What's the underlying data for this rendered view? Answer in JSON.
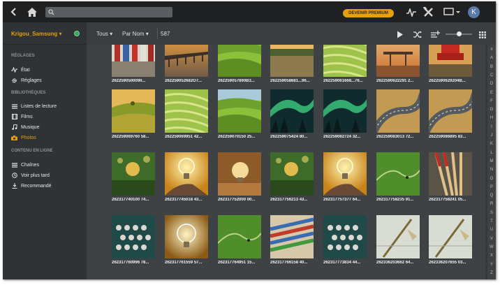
{
  "topbar": {
    "icons": [
      "back-arrow-icon",
      "home-icon",
      "search-icon",
      "activity-icon",
      "settings-tools-icon",
      "cast-icon"
    ],
    "search": {
      "value": "",
      "placeholder": ""
    },
    "premium_label": "DEVENIR PREMIUM",
    "avatar_letter": "K"
  },
  "sidebar": {
    "server_name": "Krigou_Samsung",
    "server_status_color": "#3aa65a",
    "sections": [
      {
        "title": "RÉGLAGES",
        "items": [
          {
            "label": "État",
            "icon": "activity-icon"
          },
          {
            "label": "Réglages",
            "icon": "gear-icon"
          }
        ]
      },
      {
        "title": "BIBLIOTHÈQUES",
        "items": [
          {
            "label": "Listes de lecture",
            "icon": "list-icon"
          },
          {
            "label": "Films",
            "icon": "film-icon"
          },
          {
            "label": "Musique",
            "icon": "music-note-icon"
          },
          {
            "label": "Photos",
            "icon": "camera-icon",
            "active": true
          }
        ]
      },
      {
        "title": "CONTENU EN LIGNE",
        "items": [
          {
            "label": "Chaînes",
            "icon": "list-icon"
          },
          {
            "label": "Voir plus tard",
            "icon": "clock-icon"
          },
          {
            "label": "Recommandé",
            "icon": "download-icon"
          }
        ]
      }
    ]
  },
  "toolbar": {
    "filter_label": "Tous",
    "sort_label": "Par Nom",
    "count": "587",
    "icons": [
      "play-icon",
      "shuffle-icon",
      "playlist-add-icon",
      "size-slider",
      "grid-view-icon"
    ]
  },
  "tiles": [
    {
      "label": "262259050009II...",
      "scene": "shops"
    },
    {
      "label": "262259052682O7...",
      "scene": "pier"
    },
    {
      "label": "262259057890B3...",
      "scene": "field"
    },
    {
      "label": "262259058681...96...",
      "scene": "lake"
    },
    {
      "label": "262259061668...76...",
      "scene": "rice"
    },
    {
      "label": "2622590622291 2...",
      "scene": "sunset-pier"
    },
    {
      "label": "2622590629204B...",
      "scene": "redchair"
    },
    {
      "label": "262259069760 58...",
      "scene": "hill"
    },
    {
      "label": "262259069951 42...",
      "scene": "rice"
    },
    {
      "label": "262259070150 25...",
      "scene": "field"
    },
    {
      "label": "262259075424 80...",
      "scene": "aurora"
    },
    {
      "label": "262259082724 32...",
      "scene": "aurora"
    },
    {
      "label": "262259083013 72...",
      "scene": "road"
    },
    {
      "label": "262259086895 83...",
      "scene": "road"
    },
    {
      "label": "262317740100 74...",
      "scene": "bokeh"
    },
    {
      "label": "262317745018 43...",
      "scene": "bulb-hand"
    },
    {
      "label": "262317752000 00...",
      "scene": "bulb-wood"
    },
    {
      "label": "262317756213 43...",
      "scene": "bokeh"
    },
    {
      "label": "262317757377 64...",
      "scene": "bulb-hand"
    },
    {
      "label": "262317758235 91...",
      "scene": "meadow"
    },
    {
      "label": "262317758241 05...",
      "scene": "pencils-dark"
    },
    {
      "label": "262317760996 78...",
      "scene": "typewriter"
    },
    {
      "label": "262317761559 57...",
      "scene": "bulb-glow"
    },
    {
      "label": "262317764951 15...",
      "scene": "meadow"
    },
    {
      "label": "262317766158 40...",
      "scene": "pencils"
    },
    {
      "label": "262317773834 44...",
      "scene": "typewriter"
    },
    {
      "label": "262336203662 64...",
      "scene": "needle"
    },
    {
      "label": "262336207655 03...",
      "scene": "needle"
    }
  ],
  "alphabet": [
    "#",
    "A",
    "B",
    "C",
    "D",
    "E",
    "F",
    "G",
    "H",
    "I",
    "J",
    "K",
    "L",
    "M",
    "N",
    "O",
    "P",
    "Q",
    "R",
    "S",
    "T",
    "U",
    "V",
    "W",
    "X",
    "Y",
    "Z"
  ],
  "colors": {
    "accent": "#e5a00d",
    "topbar": "#1e2022",
    "sidebar": "#303336",
    "content": "#3f4245"
  }
}
